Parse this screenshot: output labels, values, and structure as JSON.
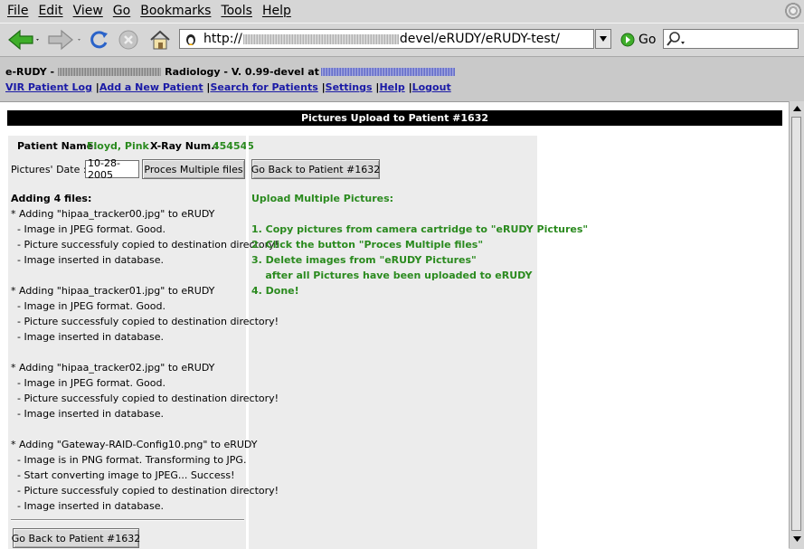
{
  "menu": [
    "File",
    "Edit",
    "View",
    "Go",
    "Bookmarks",
    "Tools",
    "Help"
  ],
  "navbar": {
    "url_prefix": "http://",
    "url_suffix": "devel/eRUDY/eRUDY-test/",
    "go_label": "Go",
    "search_value": ""
  },
  "app": {
    "title_prefix": "e-RUDY -",
    "title_middle": "Radiology - V. 0.99-devel at",
    "nav": [
      "VIR Patient Log",
      "Add a New Patient",
      "Search for Patients",
      "Settings",
      "Help",
      "Logout"
    ]
  },
  "page": {
    "banner": "Pictures Upload to Patient #1632",
    "patient_name_label": "Patient Name:",
    "patient_name": "Floyd, Pink",
    "xray_label": "X-Ray Num.:",
    "xray_num": "454545",
    "date_label": "Pictures' Date :",
    "date_value": "10-28-2005",
    "process_button": "Proces Multiple files",
    "back_button": "Go Back to Patient #1632",
    "back_button_bottom": "Go Back to Patient #1632",
    "log_heading": "Adding 4 files:",
    "log_lines": [
      "* Adding \"hipaa_tracker00.jpg\" to eRUDY",
      "  - Image in JPEG format. Good.",
      "  - Picture successfuly copied to destination directory!",
      "  - Image inserted in database.",
      "",
      "* Adding \"hipaa_tracker01.jpg\" to eRUDY",
      "  - Image in JPEG format. Good.",
      "  - Picture successfuly copied to destination directory!",
      "  - Image inserted in database.",
      "",
      "* Adding \"hipaa_tracker02.jpg\" to eRUDY",
      "  - Image in JPEG format. Good.",
      "  - Picture successfuly copied to destination directory!",
      "  - Image inserted in database.",
      "",
      "* Adding \"Gateway-RAID-Config10.png\" to eRUDY",
      "  - Image is in PNG format. Transforming to JPG.",
      "  - Start converting image to JPEG... Success!",
      "  - Picture successfuly copied to destination directory!",
      "  - Image inserted in database."
    ],
    "instructions_heading": "Upload Multiple Pictures:",
    "instructions": [
      "1. Copy pictures from camera cartridge to \"eRUDY Pictures\"",
      "2. Click the button \"Proces Multiple files\"",
      "3. Delete images from \"eRUDY Pictures\"",
      "    after all Pictures have been uploaded to eRUDY",
      "4. Done!"
    ]
  },
  "icons": {
    "back": "back-arrow-icon",
    "forward": "forward-arrow-icon",
    "reload": "reload-icon",
    "stop": "stop-icon",
    "home": "home-icon",
    "site": "penguin-site-icon",
    "go": "go-icon",
    "search": "magnifier-icon"
  },
  "colors": {
    "accent_green": "#2a8a1e",
    "link_blue": "#1a1aa6",
    "banner_bg": "#000000"
  }
}
